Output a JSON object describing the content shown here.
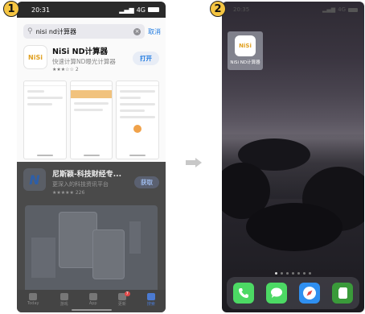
{
  "left_phone": {
    "step": "1",
    "status_time": "20:31",
    "signal_text": "4G",
    "search_query": "nisi nd计算器",
    "cancel_label": "取消",
    "app": {
      "name": "NiSi ND计算器",
      "subtitle": "快速计算ND曝光计算器",
      "rating_count": "2",
      "get_label": "打开",
      "icon_text": "NiSi"
    },
    "ad": {
      "name": "尼斯颖-科技财经专...",
      "subtitle": "更深入的科技资讯平台",
      "rating_count": "226",
      "get_label": "获取",
      "icon_text": "N"
    },
    "tabs": [
      {
        "label": "Today"
      },
      {
        "label": "游戏"
      },
      {
        "label": "App"
      },
      {
        "label": "更新",
        "badge": "7"
      },
      {
        "label": "搜索"
      }
    ]
  },
  "right_phone": {
    "step": "2",
    "status_time": "20:35",
    "signal_text": "4G",
    "home_app": {
      "icon_text": "NiSi",
      "label": "NiSi ND计算器"
    },
    "dock": [
      {
        "icon": "phone-icon",
        "color": "#4cd964"
      },
      {
        "icon": "messages-icon",
        "color": "#4cd964"
      },
      {
        "icon": "safari-icon",
        "color": "#2f8ff0"
      },
      {
        "icon": "evernote-icon",
        "color": "#3a9a3a"
      }
    ]
  }
}
